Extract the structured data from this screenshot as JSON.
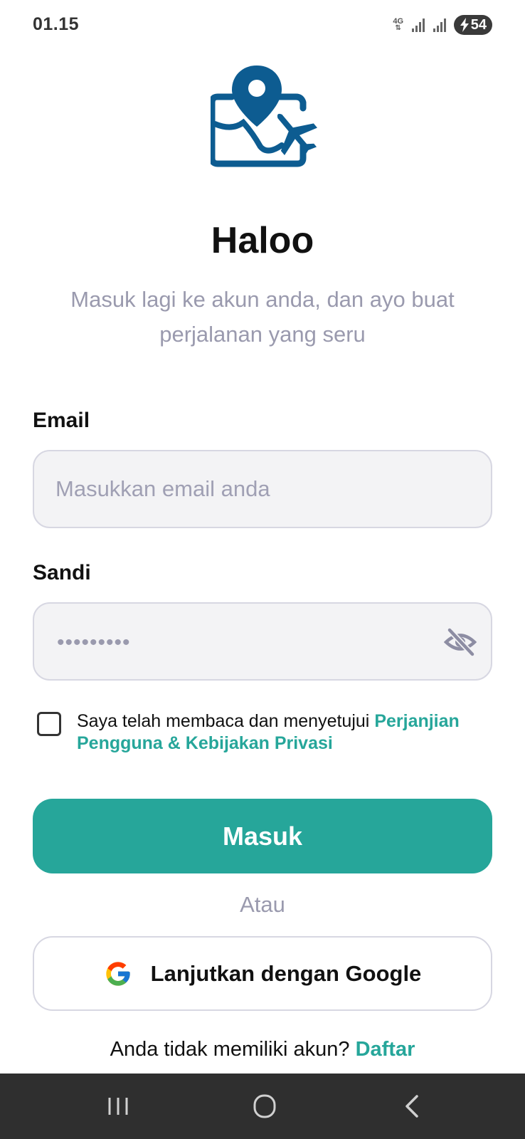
{
  "status_bar": {
    "time": "01.15",
    "network_type": "4G",
    "battery_level": "54",
    "icons": [
      "signal-icon",
      "signal-icon",
      "battery-charging-icon"
    ]
  },
  "logo": {
    "icon": "map-pin-airplane-icon",
    "color": "#0d5c91"
  },
  "header": {
    "title": "Haloo",
    "subtitle": "Masuk lagi ke akun anda, dan ayo buat perjalanan yang seru"
  },
  "form": {
    "email_label": "Email",
    "email_placeholder": "Masukkan email anda",
    "password_label": "Sandi",
    "password_value": "•••••••••",
    "password_toggle_icon": "eye-off-icon"
  },
  "agreement": {
    "text": "Saya telah membaca dan menyetujui ",
    "link_text": "Perjanjian Pengguna & Kebijakan Privasi",
    "checked": false
  },
  "actions": {
    "login_label": "Masuk",
    "or_label": "Atau",
    "google_label": "Lanjutkan dengan Google",
    "google_icon": "google-icon"
  },
  "signup": {
    "prompt": "Anda tidak memiliki akun? ",
    "link_text": "Daftar"
  },
  "nav": {
    "icons": [
      "recent-apps-icon",
      "home-icon",
      "back-icon"
    ]
  },
  "colors": {
    "accent": "#26a69a",
    "logo_blue": "#0d5c91",
    "muted_text": "#9a9aae",
    "input_bg": "#f3f3f5",
    "nav_bg": "#2f2f2f"
  }
}
